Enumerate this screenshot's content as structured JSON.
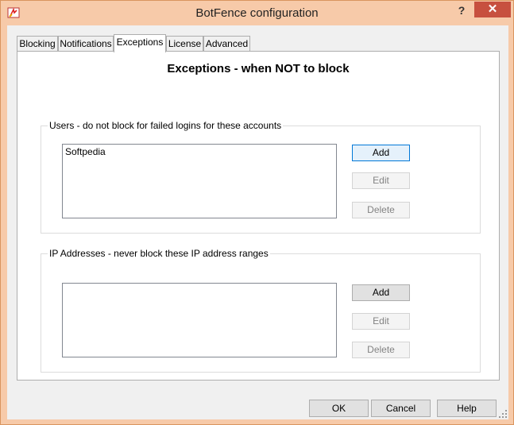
{
  "window": {
    "title": "BotFence configuration",
    "help_glyph": "?",
    "close_glyph": "✕"
  },
  "tabs": [
    {
      "label": "Blocking",
      "active": false
    },
    {
      "label": "Notifications",
      "active": false
    },
    {
      "label": "Exceptions",
      "active": true
    },
    {
      "label": "License",
      "active": false
    },
    {
      "label": "Advanced",
      "active": false
    }
  ],
  "panel": {
    "heading": "Exceptions - when NOT to block",
    "users_group": {
      "label": "Users - do not block for failed logins for these accounts",
      "items": [
        "Softpedia"
      ],
      "add_label": "Add",
      "edit_label": "Edit",
      "delete_label": "Delete"
    },
    "ip_group": {
      "label": "IP Addresses - never block these IP address ranges",
      "items": [],
      "add_label": "Add",
      "edit_label": "Edit",
      "delete_label": "Delete"
    }
  },
  "footer": {
    "ok_label": "OK",
    "cancel_label": "Cancel",
    "help_label": "Help"
  },
  "colors": {
    "titlebar": "#f7caa9",
    "close_button": "#c7503f",
    "client_bg": "#f0f0f0"
  }
}
